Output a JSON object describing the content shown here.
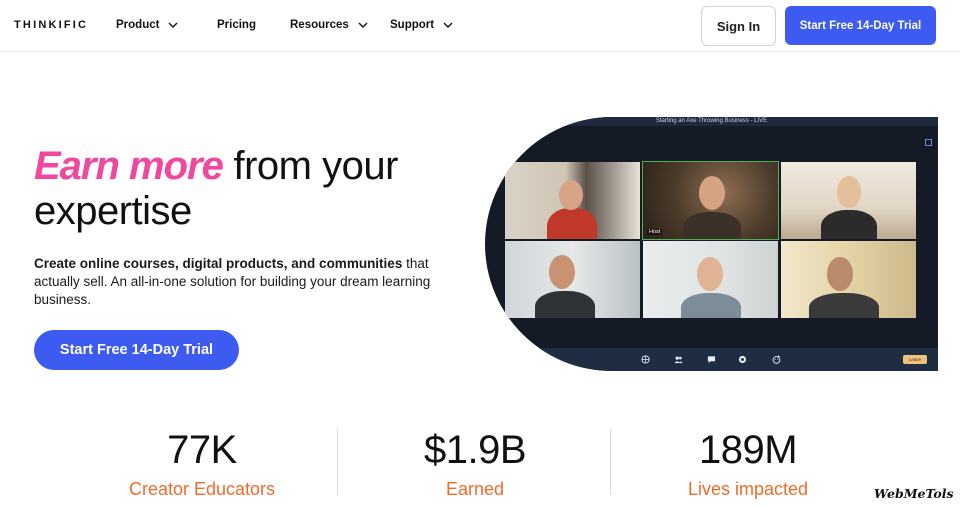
{
  "nav": {
    "logo": "THINKIFIC",
    "items": [
      {
        "label": "Product",
        "has_dropdown": true
      },
      {
        "label": "Pricing",
        "has_dropdown": false
      },
      {
        "label": "Resources",
        "has_dropdown": true
      },
      {
        "label": "Support",
        "has_dropdown": true
      }
    ],
    "sign_in": "Sign In",
    "trial": "Start Free 14-Day Trial"
  },
  "hero": {
    "headline_accent": "Earn more",
    "headline_rest": " from your expertise",
    "desc_bold": "Create online courses, digital products, and communities",
    "desc_rest": " that actually sell. An all-in-one solution for building your dream learning business.",
    "cta": "Start Free 14-Day Trial"
  },
  "call": {
    "title": "Starting an Axe Throwing Business - LIVE",
    "host_label": "Host",
    "leave_label": "Leave",
    "toolbar_icons": [
      "globe-icon",
      "people-icon",
      "chat-icon",
      "share-icon",
      "reactions-icon"
    ]
  },
  "stats": [
    {
      "value": "77K",
      "label": "Creator Educators"
    },
    {
      "value": "$1.9B",
      "label": "Earned"
    },
    {
      "value": "189M",
      "label": "Lives impacted"
    }
  ],
  "watermark": "WebMeTols",
  "colors": {
    "accent_pink": "#f0479f",
    "primary_blue": "#3d5af1",
    "stat_orange": "#ef6b2d"
  }
}
